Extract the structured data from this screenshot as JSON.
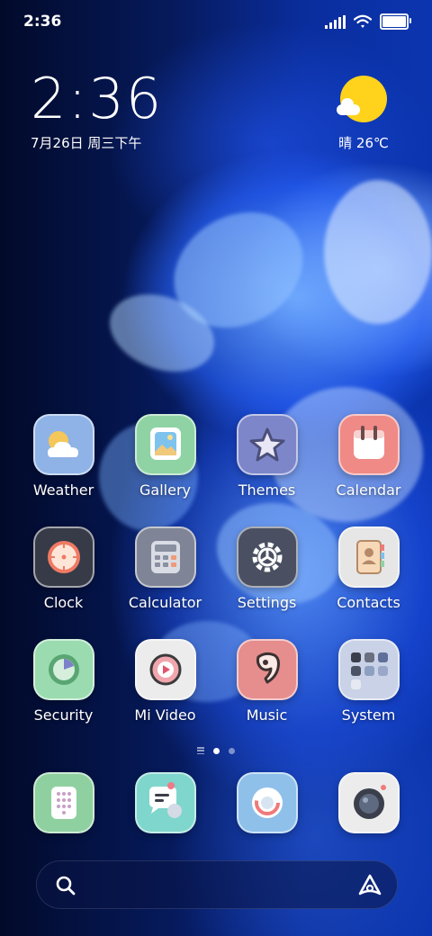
{
  "status_bar": {
    "time": "2:36",
    "battery_level": 1.0
  },
  "clock_widget": {
    "time": "2:36",
    "date": "7月26日 周三下午"
  },
  "weather_widget": {
    "text": "晴 26℃",
    "condition_icon": "sunny-cloud-icon"
  },
  "apps": [
    {
      "label": "Weather",
      "icon": "weather-icon",
      "bg": "#8fb3e6"
    },
    {
      "label": "Gallery",
      "icon": "gallery-icon",
      "bg": "#8fd3a4"
    },
    {
      "label": "Themes",
      "icon": "themes-star-icon",
      "bg": "#7d86c9"
    },
    {
      "label": "Calendar",
      "icon": "calendar-icon",
      "bg": "#f08a86"
    },
    {
      "label": "Clock",
      "icon": "clock-icon",
      "bg": "#363b47"
    },
    {
      "label": "Calculator",
      "icon": "calculator-icon",
      "bg": "#7f8596"
    },
    {
      "label": "Settings",
      "icon": "settings-gear-icon",
      "bg": "#4a5061"
    },
    {
      "label": "Contacts",
      "icon": "contacts-book-icon",
      "bg": "#e6e6e6"
    },
    {
      "label": "Security",
      "icon": "security-icon",
      "bg": "#9adbb0"
    },
    {
      "label": "Mi Video",
      "icon": "video-play-icon",
      "bg": "#ececec"
    },
    {
      "label": "Music",
      "icon": "music-note-icon",
      "bg": "#e68d8d"
    },
    {
      "label": "System",
      "icon": "system-folder-icon",
      "bg": "#c9d2e6"
    }
  ],
  "dock": [
    {
      "icon": "phone-dialer-icon",
      "bg": "#8fd0a0"
    },
    {
      "icon": "messages-icon",
      "bg": "#7fd6cc"
    },
    {
      "icon": "browser-icon",
      "bg": "#8fc0ea"
    },
    {
      "icon": "camera-icon",
      "bg": "#ececec"
    }
  ],
  "page_indicator": {
    "pages": 2,
    "current": 1
  },
  "search_bar": {
    "left_icon": "search-icon",
    "right_icon": "assistant-icon"
  }
}
